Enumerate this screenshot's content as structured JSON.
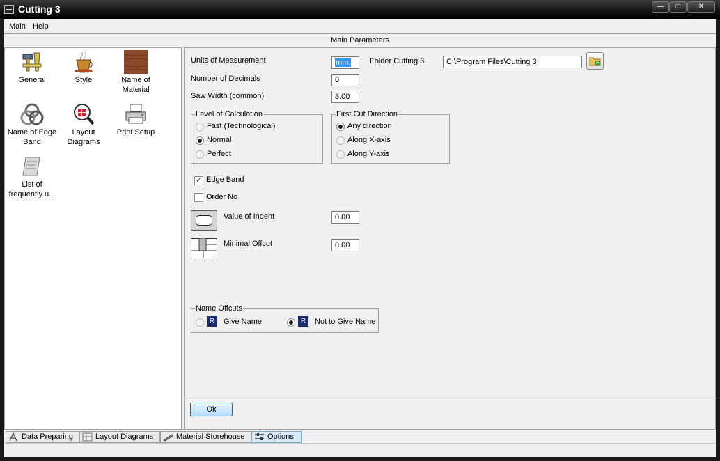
{
  "window": {
    "title": "Cutting 3"
  },
  "menu": {
    "items": [
      "Main",
      "Help"
    ]
  },
  "header": {
    "title": "Main Parameters"
  },
  "nav": {
    "items": [
      {
        "label": "General",
        "icon": "tools-icon"
      },
      {
        "label": "Style",
        "icon": "coffee-cup-icon"
      },
      {
        "label": "Name of Material",
        "icon": "wood-texture-icon"
      },
      {
        "label": "Name of Edge Band",
        "icon": "edge-band-icon"
      },
      {
        "label": "Layout Diagrams",
        "icon": "layout-magnifier-icon"
      },
      {
        "label": "Print Setup",
        "icon": "printer-icon"
      },
      {
        "label": "List of frequently u...",
        "icon": "scroll-icon"
      }
    ]
  },
  "params": {
    "units_label": "Units of Measurement",
    "units_value": "mm.",
    "folder_label": "Folder Cutting 3",
    "folder_value": "C:\\Program Files\\Cutting 3",
    "decimals_label": "Number of Decimals",
    "decimals_value": "0",
    "saw_label": "Saw Width (common)",
    "saw_value": "3.00"
  },
  "calc_group": {
    "title": "Level of Calculation",
    "options": [
      "Fast (Technological)",
      "Normal",
      "Perfect"
    ],
    "selected": 1
  },
  "cut_group": {
    "title": "First Cut Direction",
    "options": [
      "Any direction",
      "Along X-axis",
      "Along Y-axis"
    ],
    "selected": 0
  },
  "checks": {
    "edge_band": "Edge Band",
    "edge_band_checked": true,
    "order_no": "Order No",
    "order_no_checked": false
  },
  "indent": {
    "label": "Value of Indent",
    "value": "0.00"
  },
  "offcut": {
    "label": "Minimal Offcut",
    "value": "0.00"
  },
  "name_offcuts": {
    "title": "Name Offcuts",
    "give": "Give Name",
    "not_give": "Not to Give Name",
    "badge": "R",
    "selected": 1
  },
  "ok_label": "Ok",
  "tabs": [
    {
      "label": "Data Preparing",
      "icon": "compass-icon"
    },
    {
      "label": "Layout Diagrams",
      "icon": "layout-grid-icon"
    },
    {
      "label": "Material Storehouse",
      "icon": "saw-icon"
    },
    {
      "label": "Options",
      "icon": "options-tools-icon"
    }
  ],
  "active_tab": 3,
  "colors": {
    "accent": "#1f5fa8",
    "selection": "#3399ff",
    "badge": "#1b2a6b"
  }
}
